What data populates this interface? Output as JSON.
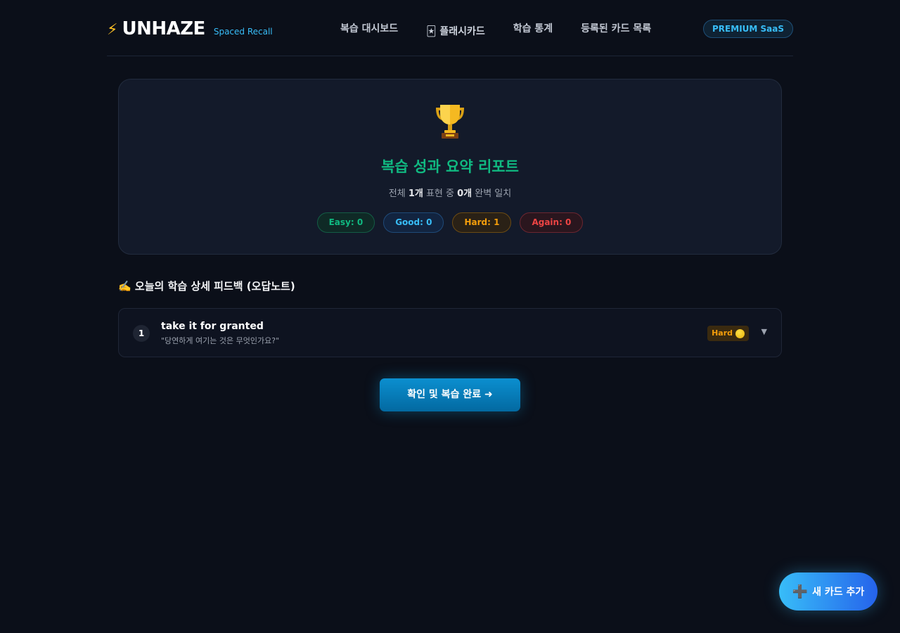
{
  "header": {
    "logo_bolt": "⚡",
    "logo_text": "UNHAZE",
    "logo_sub": "Spaced Recall",
    "nav": [
      {
        "label": "복습 대시보드"
      },
      {
        "label": "🃏 플래시카드"
      },
      {
        "label": "학습 통계"
      },
      {
        "label": "등록된 카드 목록"
      }
    ],
    "badge": "PREMIUM SaaS"
  },
  "summary": {
    "title": "복습 성과 요약 리포트",
    "sub_prefix": "전체 ",
    "total": "1개",
    "sub_mid": " 표현 중 ",
    "perfect": "0개",
    "sub_suffix": " 완벽 일치",
    "pills": {
      "easy": "Easy: 0",
      "good": "Good: 0",
      "hard": "Hard: 1",
      "again": "Again: 0"
    }
  },
  "feedback": {
    "title": "✍️ 오늘의 학습 상세 피드백 (오답노트)",
    "items": [
      {
        "num": "1",
        "term": "take it for granted",
        "question": "\"당연하게 여기는 것은 무엇인가요?\"",
        "rating": "Hard",
        "toggle": "▼"
      }
    ]
  },
  "confirm_label": "확인 및 복습 완료 ➜",
  "fab": {
    "plus": "➕",
    "label": "새 카드 추가"
  },
  "colors": {
    "background": "#0b0f19",
    "accent": "#38bdf8",
    "easy": "#10b981",
    "good": "#38bdf8",
    "hard": "#f59e0b",
    "again": "#ef4444"
  },
  "icons": {
    "logo": "lightning-icon",
    "trophy": "trophy-icon",
    "rating": "yellow-circle-icon",
    "toggle": "chevron-down-icon",
    "fab": "plus-icon"
  }
}
